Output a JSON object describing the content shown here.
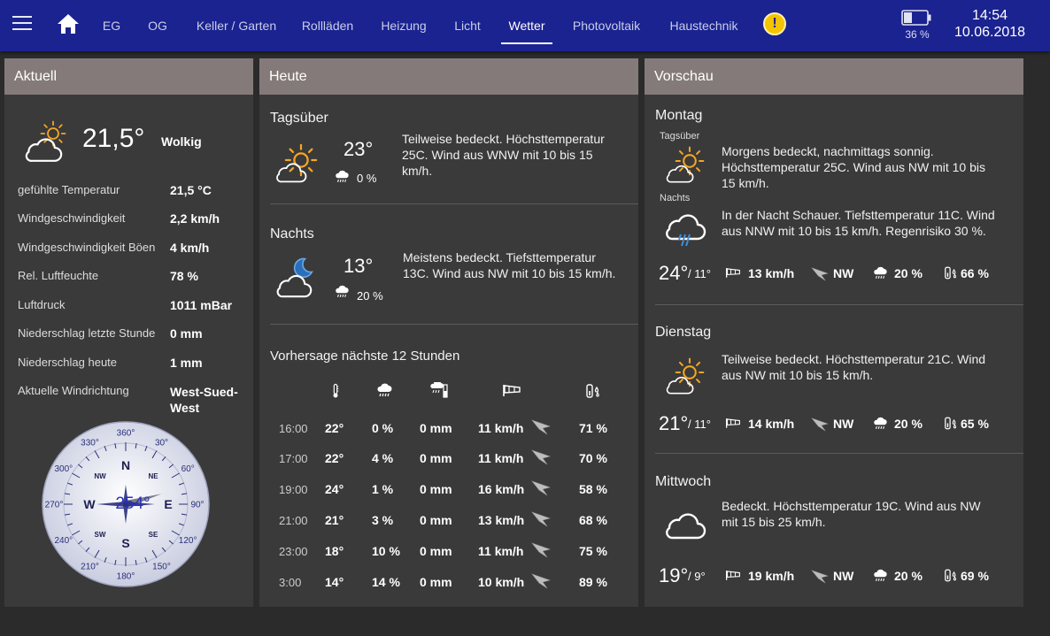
{
  "topbar": {
    "tabs": [
      {
        "label": "EG"
      },
      {
        "label": "OG"
      },
      {
        "label": "Keller / Garten"
      },
      {
        "label": "Rollläden"
      },
      {
        "label": "Heizung"
      },
      {
        "label": "Licht"
      },
      {
        "label": "Wetter",
        "active": true
      },
      {
        "label": "Photovoltaik"
      },
      {
        "label": "Haustechnik"
      }
    ],
    "alert_symbol": "!",
    "battery_percent": "36 %",
    "battery_level": 0.36,
    "time": "14:54",
    "date": "10.06.2018"
  },
  "aktuell": {
    "title": "Aktuell",
    "icon": "cloud-sun-icon",
    "temperature": "21,5°",
    "condition": "Wolkig",
    "rows": [
      {
        "label": "gefühlte Temperatur",
        "value": "21,5 °C"
      },
      {
        "label": "Windgeschwindigkeit",
        "value": "2,2 km/h"
      },
      {
        "label": "Windgeschwindigkeit Böen",
        "value": "4 km/h"
      },
      {
        "label": "Rel. Luftfeuchte",
        "value": "78 %"
      },
      {
        "label": "Luftdruck",
        "value": "1011 mBar"
      },
      {
        "label": "Niederschlag letzte Stunde",
        "value": "0 mm"
      },
      {
        "label": "Niederschlag heute",
        "value": "1 mm"
      },
      {
        "label": "Aktuelle Windrichtung",
        "value": "West-Sued-West"
      }
    ],
    "compass": {
      "reading": "254°",
      "direction_degrees": 254,
      "cardinals": {
        "n": "N",
        "e": "E",
        "s": "S",
        "w": "W"
      },
      "intercardinals": {
        "nw": "NW",
        "ne": "NE",
        "sw": "SW",
        "se": "SE"
      },
      "degree_labels": [
        "360°",
        "30°",
        "60°",
        "90°",
        "120°",
        "150°",
        "180°",
        "210°",
        "240°",
        "270°",
        "300°",
        "330°"
      ]
    }
  },
  "heute": {
    "title": "Heute",
    "day": {
      "label": "Tagsüber",
      "icon": "sun-cloud-icon",
      "temp": "23°",
      "rain": "0 %",
      "text": "Teilweise bedeckt. Höchsttemperatur 25C. Wind aus WNW mit 10 bis 15 km/h."
    },
    "night": {
      "label": "Nachts",
      "icon": "moon-cloud-icon",
      "temp": "13°",
      "rain": "20 %",
      "text": "Meistens bedeckt. Tiefsttemperatur 13C. Wind aus NW mit 10 bis 15 km/h."
    },
    "forecast_title": "Vorhersage nächste 12 Stunden",
    "forecast_icons": [
      "thermometer-icon",
      "rain-cloud-icon",
      "rain-gauge-icon",
      "windsock-icon",
      "humidity-icon"
    ],
    "forecast": [
      {
        "time": "16:00",
        "temp": "22°",
        "rain_prob": "0 %",
        "rain": "0 mm",
        "wind": "11 km/h",
        "humidity": "71 %"
      },
      {
        "time": "17:00",
        "temp": "22°",
        "rain_prob": "4 %",
        "rain": "0 mm",
        "wind": "11 km/h",
        "humidity": "70 %"
      },
      {
        "time": "19:00",
        "temp": "24°",
        "rain_prob": "1 %",
        "rain": "0 mm",
        "wind": "16 km/h",
        "humidity": "58 %"
      },
      {
        "time": "21:00",
        "temp": "21°",
        "rain_prob": "3 %",
        "rain": "0 mm",
        "wind": "13 km/h",
        "humidity": "68 %"
      },
      {
        "time": "23:00",
        "temp": "18°",
        "rain_prob": "10 %",
        "rain": "0 mm",
        "wind": "11 km/h",
        "humidity": "75 %"
      },
      {
        "time": "3:00",
        "temp": "14°",
        "rain_prob": "14 %",
        "rain": "0 mm",
        "wind": "10 km/h",
        "humidity": "89 %"
      }
    ]
  },
  "vorschau": {
    "title": "Vorschau",
    "days": [
      {
        "name": "Montag",
        "day_label": "Tagsüber",
        "day_text": "Morgens bedeckt, nachmittags sonnig. Höchsttemperatur 25C. Wind aus NW mit 10 bis 15 km/h.",
        "night_label": "Nachts",
        "night_text": "In der Nacht Schauer. Tiefsttemperatur 11C. Wind aus NNW mit 10 bis 15 km/h. Regenrisiko 30 %.",
        "high": "24°",
        "low": "/ 11°",
        "wind": "13 km/h",
        "wind_dir": "NW",
        "rain": "20 %",
        "humidity": "66 %"
      },
      {
        "name": "Dienstag",
        "day_text": "Teilweise bedeckt. Höchsttemperatur 21C. Wind aus NW mit 10 bis 15 km/h.",
        "high": "21°",
        "low": "/ 11°",
        "wind": "14 km/h",
        "wind_dir": "NW",
        "rain": "20 %",
        "humidity": "65 %"
      },
      {
        "name": "Mittwoch",
        "day_text": "Bedeckt. Höchsttemperatur 19C. Wind aus NW mit 15 bis 25 km/h.",
        "high": "19°",
        "low": "/ 9°",
        "wind": "19 km/h",
        "wind_dir": "NW",
        "rain": "20 %",
        "humidity": "69 %"
      }
    ]
  },
  "colors": {
    "topbar": "#1b2390",
    "panel": "#3a3a3a",
    "panel_header": "#857a7a",
    "sun": "#f5a623",
    "alert": "#f5c400"
  }
}
